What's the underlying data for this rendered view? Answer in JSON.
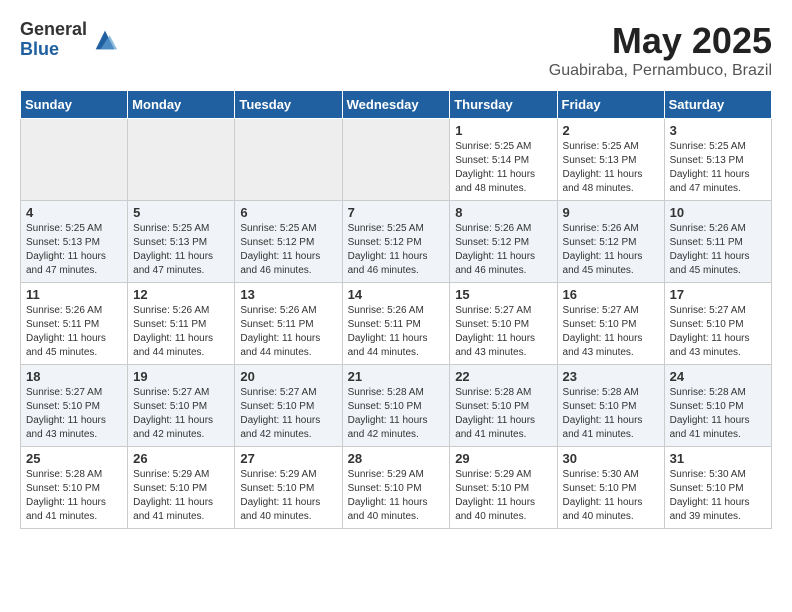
{
  "logo": {
    "general": "General",
    "blue": "Blue"
  },
  "title": "May 2025",
  "location": "Guabiraba, Pernambuco, Brazil",
  "days_of_week": [
    "Sunday",
    "Monday",
    "Tuesday",
    "Wednesday",
    "Thursday",
    "Friday",
    "Saturday"
  ],
  "weeks": [
    [
      {
        "day": "",
        "empty": true
      },
      {
        "day": "",
        "empty": true
      },
      {
        "day": "",
        "empty": true
      },
      {
        "day": "",
        "empty": true
      },
      {
        "day": "1",
        "sunrise": "Sunrise: 5:25 AM",
        "sunset": "Sunset: 5:14 PM",
        "daylight": "Daylight: 11 hours and 48 minutes."
      },
      {
        "day": "2",
        "sunrise": "Sunrise: 5:25 AM",
        "sunset": "Sunset: 5:13 PM",
        "daylight": "Daylight: 11 hours and 48 minutes."
      },
      {
        "day": "3",
        "sunrise": "Sunrise: 5:25 AM",
        "sunset": "Sunset: 5:13 PM",
        "daylight": "Daylight: 11 hours and 47 minutes."
      }
    ],
    [
      {
        "day": "4",
        "sunrise": "Sunrise: 5:25 AM",
        "sunset": "Sunset: 5:13 PM",
        "daylight": "Daylight: 11 hours and 47 minutes."
      },
      {
        "day": "5",
        "sunrise": "Sunrise: 5:25 AM",
        "sunset": "Sunset: 5:13 PM",
        "daylight": "Daylight: 11 hours and 47 minutes."
      },
      {
        "day": "6",
        "sunrise": "Sunrise: 5:25 AM",
        "sunset": "Sunset: 5:12 PM",
        "daylight": "Daylight: 11 hours and 46 minutes."
      },
      {
        "day": "7",
        "sunrise": "Sunrise: 5:25 AM",
        "sunset": "Sunset: 5:12 PM",
        "daylight": "Daylight: 11 hours and 46 minutes."
      },
      {
        "day": "8",
        "sunrise": "Sunrise: 5:26 AM",
        "sunset": "Sunset: 5:12 PM",
        "daylight": "Daylight: 11 hours and 46 minutes."
      },
      {
        "day": "9",
        "sunrise": "Sunrise: 5:26 AM",
        "sunset": "Sunset: 5:12 PM",
        "daylight": "Daylight: 11 hours and 45 minutes."
      },
      {
        "day": "10",
        "sunrise": "Sunrise: 5:26 AM",
        "sunset": "Sunset: 5:11 PM",
        "daylight": "Daylight: 11 hours and 45 minutes."
      }
    ],
    [
      {
        "day": "11",
        "sunrise": "Sunrise: 5:26 AM",
        "sunset": "Sunset: 5:11 PM",
        "daylight": "Daylight: 11 hours and 45 minutes."
      },
      {
        "day": "12",
        "sunrise": "Sunrise: 5:26 AM",
        "sunset": "Sunset: 5:11 PM",
        "daylight": "Daylight: 11 hours and 44 minutes."
      },
      {
        "day": "13",
        "sunrise": "Sunrise: 5:26 AM",
        "sunset": "Sunset: 5:11 PM",
        "daylight": "Daylight: 11 hours and 44 minutes."
      },
      {
        "day": "14",
        "sunrise": "Sunrise: 5:26 AM",
        "sunset": "Sunset: 5:11 PM",
        "daylight": "Daylight: 11 hours and 44 minutes."
      },
      {
        "day": "15",
        "sunrise": "Sunrise: 5:27 AM",
        "sunset": "Sunset: 5:10 PM",
        "daylight": "Daylight: 11 hours and 43 minutes."
      },
      {
        "day": "16",
        "sunrise": "Sunrise: 5:27 AM",
        "sunset": "Sunset: 5:10 PM",
        "daylight": "Daylight: 11 hours and 43 minutes."
      },
      {
        "day": "17",
        "sunrise": "Sunrise: 5:27 AM",
        "sunset": "Sunset: 5:10 PM",
        "daylight": "Daylight: 11 hours and 43 minutes."
      }
    ],
    [
      {
        "day": "18",
        "sunrise": "Sunrise: 5:27 AM",
        "sunset": "Sunset: 5:10 PM",
        "daylight": "Daylight: 11 hours and 43 minutes."
      },
      {
        "day": "19",
        "sunrise": "Sunrise: 5:27 AM",
        "sunset": "Sunset: 5:10 PM",
        "daylight": "Daylight: 11 hours and 42 minutes."
      },
      {
        "day": "20",
        "sunrise": "Sunrise: 5:27 AM",
        "sunset": "Sunset: 5:10 PM",
        "daylight": "Daylight: 11 hours and 42 minutes."
      },
      {
        "day": "21",
        "sunrise": "Sunrise: 5:28 AM",
        "sunset": "Sunset: 5:10 PM",
        "daylight": "Daylight: 11 hours and 42 minutes."
      },
      {
        "day": "22",
        "sunrise": "Sunrise: 5:28 AM",
        "sunset": "Sunset: 5:10 PM",
        "daylight": "Daylight: 11 hours and 41 minutes."
      },
      {
        "day": "23",
        "sunrise": "Sunrise: 5:28 AM",
        "sunset": "Sunset: 5:10 PM",
        "daylight": "Daylight: 11 hours and 41 minutes."
      },
      {
        "day": "24",
        "sunrise": "Sunrise: 5:28 AM",
        "sunset": "Sunset: 5:10 PM",
        "daylight": "Daylight: 11 hours and 41 minutes."
      }
    ],
    [
      {
        "day": "25",
        "sunrise": "Sunrise: 5:28 AM",
        "sunset": "Sunset: 5:10 PM",
        "daylight": "Daylight: 11 hours and 41 minutes."
      },
      {
        "day": "26",
        "sunrise": "Sunrise: 5:29 AM",
        "sunset": "Sunset: 5:10 PM",
        "daylight": "Daylight: 11 hours and 41 minutes."
      },
      {
        "day": "27",
        "sunrise": "Sunrise: 5:29 AM",
        "sunset": "Sunset: 5:10 PM",
        "daylight": "Daylight: 11 hours and 40 minutes."
      },
      {
        "day": "28",
        "sunrise": "Sunrise: 5:29 AM",
        "sunset": "Sunset: 5:10 PM",
        "daylight": "Daylight: 11 hours and 40 minutes."
      },
      {
        "day": "29",
        "sunrise": "Sunrise: 5:29 AM",
        "sunset": "Sunset: 5:10 PM",
        "daylight": "Daylight: 11 hours and 40 minutes."
      },
      {
        "day": "30",
        "sunrise": "Sunrise: 5:30 AM",
        "sunset": "Sunset: 5:10 PM",
        "daylight": "Daylight: 11 hours and 40 minutes."
      },
      {
        "day": "31",
        "sunrise": "Sunrise: 5:30 AM",
        "sunset": "Sunset: 5:10 PM",
        "daylight": "Daylight: 11 hours and 39 minutes."
      }
    ]
  ]
}
